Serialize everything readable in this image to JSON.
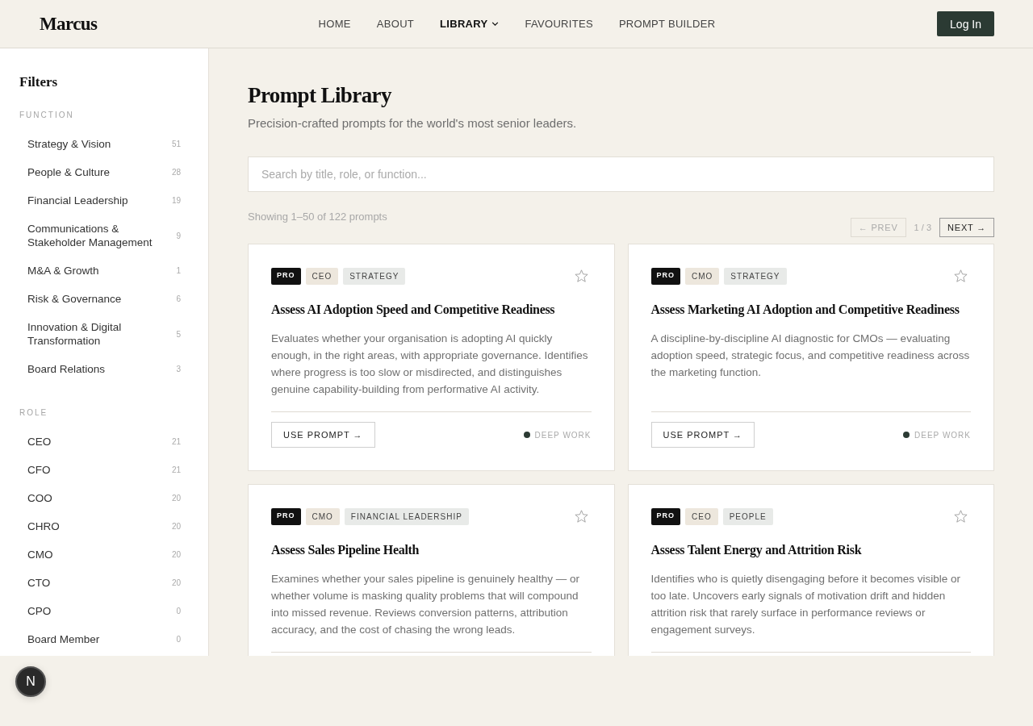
{
  "header": {
    "logo": "Marcus",
    "nav": [
      {
        "label": "HOME",
        "kind": "link",
        "selected": false
      },
      {
        "label": "ABOUT",
        "kind": "link",
        "selected": false
      },
      {
        "label": "LIBRARY",
        "kind": "menu",
        "selected": true
      },
      {
        "label": "FAVOURITES",
        "kind": "link",
        "selected": false
      },
      {
        "label": "PROMPT BUILDER",
        "kind": "link",
        "selected": false
      }
    ],
    "login_button": "Log In"
  },
  "sidebar": {
    "title": "Filters",
    "sections": [
      {
        "heading": "FUNCTION",
        "items": [
          {
            "label": "Strategy & Vision",
            "count": "51",
            "selected": false
          },
          {
            "label": "People & Culture",
            "count": "28",
            "selected": false
          },
          {
            "label": "Financial Leadership",
            "count": "19",
            "selected": false
          },
          {
            "label": "Communications & Stakeholder Management",
            "count": "9",
            "selected": false
          },
          {
            "label": "M&A & Growth",
            "count": "1",
            "selected": false
          },
          {
            "label": "Risk & Governance",
            "count": "6",
            "selected": false
          },
          {
            "label": "Innovation & Digital Transformation",
            "count": "5",
            "selected": false
          },
          {
            "label": "Board Relations",
            "count": "3",
            "selected": false
          }
        ]
      },
      {
        "heading": "ROLE",
        "items": [
          {
            "label": "CEO",
            "count": "21",
            "selected": false
          },
          {
            "label": "CFO",
            "count": "21",
            "selected": false
          },
          {
            "label": "COO",
            "count": "20",
            "selected": false
          },
          {
            "label": "CHRO",
            "count": "20",
            "selected": false
          },
          {
            "label": "CMO",
            "count": "20",
            "selected": false
          },
          {
            "label": "CTO",
            "count": "20",
            "selected": false
          },
          {
            "label": "CPO",
            "count": "0",
            "selected": false
          },
          {
            "label": "Board Member",
            "count": "0",
            "selected": false
          }
        ]
      }
    ]
  },
  "main": {
    "title": "Prompt Library",
    "subtitle": "Precision-crafted prompts for the world's most senior leaders.",
    "search": {
      "placeholder": "Search by title, role, or function..."
    },
    "results_summary": "Showing 1–50 of 122 prompts",
    "pagination": {
      "prev": {
        "label": "← PREV",
        "disabled": true
      },
      "page": "1 / 3",
      "next": {
        "label": "NEXT →",
        "disabled": false
      }
    },
    "cards": [
      {
        "tags": [
          {
            "label": "PRO",
            "kind": "tier"
          },
          {
            "label": "CEO",
            "kind": "role"
          },
          {
            "label": "STRATEGY",
            "kind": "function"
          }
        ],
        "favourite": false,
        "title": "Assess AI Adoption Speed and Competitive Readiness",
        "description": "Evaluates whether your organisation is adopting AI quickly enough, in the right areas, with appropriate governance. Identifies where progress is too slow or misdirected, and distinguishes genuine capability-building from performative AI activity.",
        "action": "USE PROMPT →",
        "mode": {
          "label": "DEEP WORK",
          "color": "#2c3b34"
        }
      },
      {
        "tags": [
          {
            "label": "PRO",
            "kind": "tier"
          },
          {
            "label": "CMO",
            "kind": "role"
          },
          {
            "label": "STRATEGY",
            "kind": "function"
          }
        ],
        "favourite": false,
        "title": "Assess Marketing AI Adoption and Competitive Readiness",
        "description": "A discipline-by-discipline AI diagnostic for CMOs — evaluating adoption speed, strategic focus, and competitive readiness across the marketing function.",
        "action": "USE PROMPT →",
        "mode": {
          "label": "DEEP WORK",
          "color": "#2c3b34"
        }
      },
      {
        "tags": [
          {
            "label": "PRO",
            "kind": "tier"
          },
          {
            "label": "CMO",
            "kind": "role"
          },
          {
            "label": "FINANCIAL LEADERSHIP",
            "kind": "function"
          }
        ],
        "favourite": false,
        "title": "Assess Sales Pipeline Health",
        "description": "Examines whether your sales pipeline is genuinely healthy — or whether volume is masking quality problems that will compound into missed revenue. Reviews conversion patterns, attribution accuracy, and the cost of chasing the wrong leads."
      },
      {
        "tags": [
          {
            "label": "PRO",
            "kind": "tier"
          },
          {
            "label": "CEO",
            "kind": "role"
          },
          {
            "label": "PEOPLE",
            "kind": "function"
          }
        ],
        "favourite": false,
        "title": "Assess Talent Energy and Attrition Risk",
        "description": "Identifies who is quietly disengaging before it becomes visible or too late. Uncovers early signals of motivation drift and hidden attrition risk that rarely surface in performance reviews or engagement surveys."
      }
    ]
  },
  "dev_indicator": {
    "label": "N"
  }
}
